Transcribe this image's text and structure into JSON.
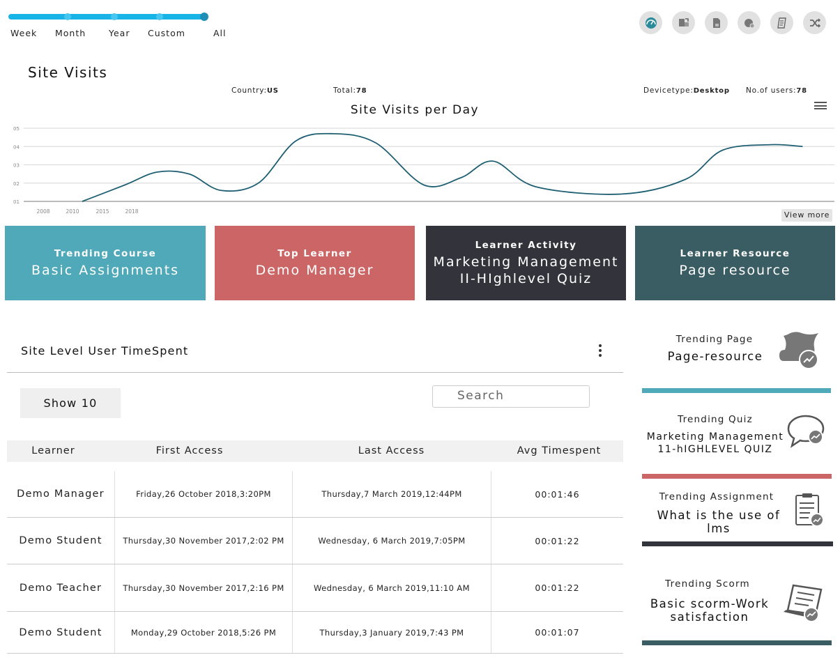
{
  "range_labels": [
    "Week",
    "Month",
    "Year",
    "Custom",
    "All"
  ],
  "toolbar": [
    {
      "name": "gauge-icon"
    },
    {
      "name": "export-icon"
    },
    {
      "name": "document-icon"
    },
    {
      "name": "report-icon"
    },
    {
      "name": "notes-icon"
    },
    {
      "name": "shuffle-icon"
    }
  ],
  "site_visits": {
    "title": "Site Visits",
    "country_label": "Country:",
    "country_value": "US",
    "total_label": "Total:",
    "total_value": "78",
    "device_label": "Devicetype:",
    "device_value": "Desktop",
    "users_label": "No.of users:",
    "users_value": "78",
    "view_more": "View more"
  },
  "chart_data": {
    "type": "line",
    "title": "Site Visits per Day",
    "y_ticks": [
      "05",
      "04",
      "03",
      "02",
      "01"
    ],
    "x_ticks": [
      "2008",
      "2010",
      "2015",
      "2018"
    ],
    "ylim": [
      1,
      5
    ],
    "grid": true,
    "line_color": "#1f5f73",
    "series": [
      {
        "points": [
          [
            0.0,
            1.0
          ],
          [
            0.08,
            1.9
          ],
          [
            0.14,
            2.6
          ],
          [
            0.2,
            2.5
          ],
          [
            0.26,
            1.6
          ],
          [
            0.33,
            2.0
          ],
          [
            0.4,
            4.3
          ],
          [
            0.47,
            4.7
          ],
          [
            0.55,
            4.2
          ],
          [
            0.64,
            1.9
          ],
          [
            0.71,
            2.3
          ],
          [
            0.77,
            3.2
          ],
          [
            0.85,
            1.8
          ],
          [
            1.01,
            1.4
          ],
          [
            1.13,
            2.2
          ],
          [
            1.2,
            3.8
          ],
          [
            1.29,
            4.1
          ],
          [
            1.35,
            4.0
          ]
        ]
      }
    ]
  },
  "cards": [
    {
      "head": "Trending Course",
      "value": "Basic Assignments",
      "color": "#4fa9b8"
    },
    {
      "head": "Top Learner",
      "value": "Demo Manager",
      "color": "#cc6666"
    },
    {
      "head": "Learner Activity",
      "value": "Marketing Management\nII-HIghlevel Quiz",
      "color": "#32333b"
    },
    {
      "head": "Learner Resource",
      "value": "Page resource",
      "color": "#3a5c63"
    }
  ],
  "table": {
    "title": "Site Level User TimeSpent",
    "show_label": "Show 10",
    "search_placeholder": "Search",
    "headers": [
      "Learner",
      "First Access",
      "Last Access",
      "Avg Timespent"
    ],
    "rows": [
      [
        "Demo Manager",
        "Friday,26 October 2018,3:20PM",
        "Thursday,7 March 2019,12:44PM",
        "00:01:46"
      ],
      [
        "Demo Student",
        "Thursday,30 November 2017,2:02 PM",
        "Wednesday, 6 March 2019,7:05PM",
        "00:01:22"
      ],
      [
        "Demo Teacher",
        "Thursday,30 November 2017,2:16 PM",
        "Wednesday, 6 March 2019,11:10 AM",
        "00:01:22"
      ],
      [
        "Demo Student",
        "Monday,29 October 2018,5:26 PM",
        "Thursday,3 January 2019,7:43 PM",
        "00:01:07"
      ]
    ]
  },
  "trending": [
    {
      "label": "Trending Page",
      "value": "Page-resource",
      "icon": "page-trend-icon",
      "bar_color": "#4fa9b8"
    },
    {
      "label": "Trending Quiz",
      "value": "Marketing Management\n11-hIGHLEVEL QUIZ",
      "icon": "chat-trend-icon",
      "bar_color": "#cc6666"
    },
    {
      "label": "Trending Assignment",
      "value": "What is the use of lms",
      "icon": "clipboard-trend-icon",
      "bar_color": "#32333b"
    },
    {
      "label": "Trending Scorm",
      "value": "Basic scorm-Work\nsatisfaction",
      "icon": "scroll-trend-icon",
      "bar_color": "#3a5c63"
    }
  ]
}
